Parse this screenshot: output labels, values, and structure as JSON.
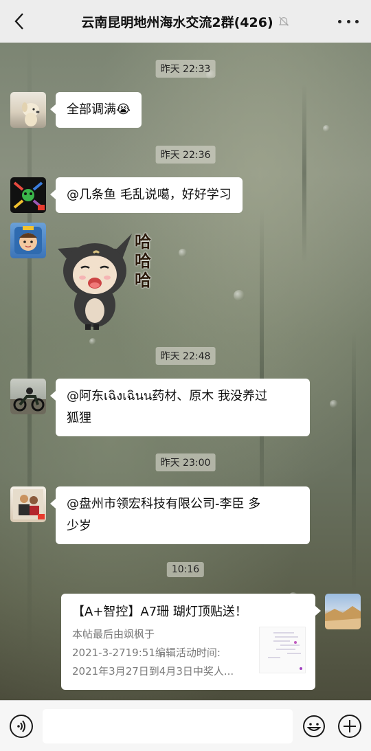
{
  "header": {
    "title": "云南昆明地州海水交流2群(426)",
    "back_icon": "chevron-left-icon",
    "mute_icon": "bell-muted-icon",
    "more_icon": "more-dots-icon"
  },
  "messages": [
    {
      "time": "昨天 22:33"
    },
    {
      "sender_avatar": "dog-avatar",
      "text": "全部调满😭"
    },
    {
      "time": "昨天 22:36"
    },
    {
      "sender_avatar": "hands-avatar",
      "text": "@几条鱼  毛乱说噶，好好学习"
    },
    {
      "sender_avatar": "child-avatar",
      "sticker": "laughing-cat-sticker",
      "sticker_text": "哈 哈 哈"
    },
    {
      "time": "昨天 22:48"
    },
    {
      "sender_avatar": "motorcycle-avatar",
      "text_line1": "@阿东เฉิงเฉินน药材、原木 我没养过",
      "text_line2": "狐狸"
    },
    {
      "time": "昨天 23:00"
    },
    {
      "sender_avatar": "group-photo-avatar",
      "text_line1": "@盘州市领宏科技有限公司-李臣   多",
      "text_line2": "少岁"
    },
    {
      "time": "10:16"
    },
    {
      "sender_avatar": "landscape-avatar",
      "card": {
        "title": "【A+智控】A7珊 瑚灯顶贴送！",
        "desc_line1": "本帖最后由飒枫于",
        "desc_line2": "2021-3-2719:51编辑活动时间:",
        "desc_line3": "2021年3月27日到4月3日中奖人..."
      }
    }
  ],
  "bottom_bar": {
    "voice_icon": "voice-input-icon",
    "input_value": "",
    "emoji_icon": "emoji-icon",
    "plus_icon": "plus-circle-icon"
  }
}
